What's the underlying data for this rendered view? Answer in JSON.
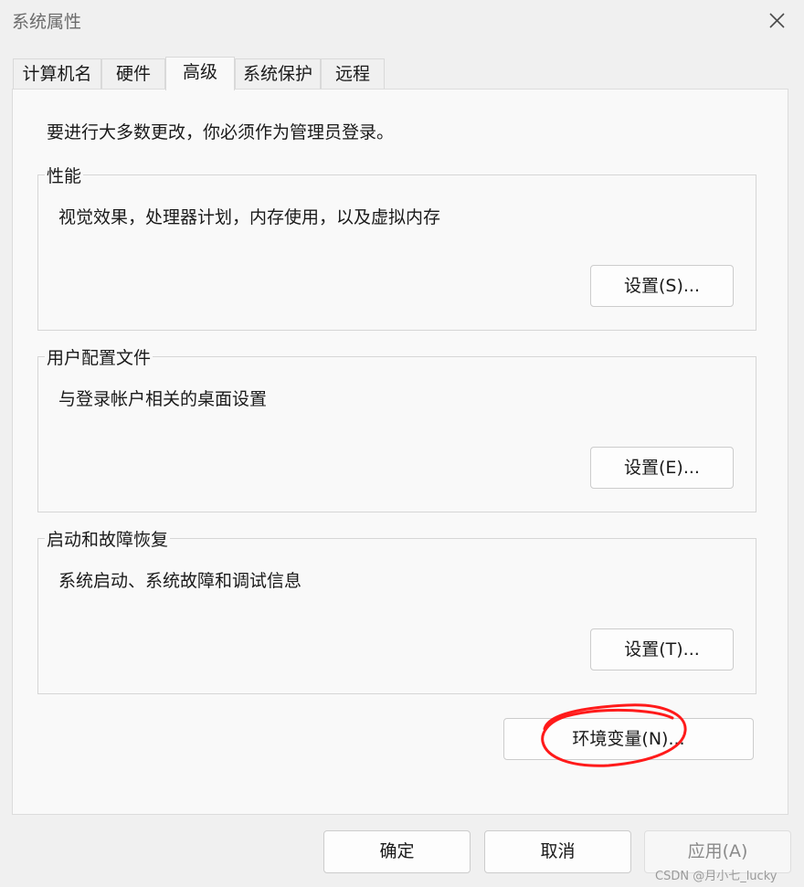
{
  "window": {
    "title": "系统属性"
  },
  "tabs": [
    {
      "label": "计算机名"
    },
    {
      "label": "硬件"
    },
    {
      "label": "高级"
    },
    {
      "label": "系统保护"
    },
    {
      "label": "远程"
    }
  ],
  "active_tab": "高级",
  "admin_note": "要进行大多数更改，你必须作为管理员登录。",
  "groups": {
    "performance": {
      "title": "性能",
      "description": "视觉效果，处理器计划，内存使用，以及虚拟内存",
      "button_label": "设置(S)..."
    },
    "user_profiles": {
      "title": "用户配置文件",
      "description": "与登录帐户相关的桌面设置",
      "button_label": "设置(E)..."
    },
    "startup_recovery": {
      "title": "启动和故障恢复",
      "description": "系统启动、系统故障和调试信息",
      "button_label": "设置(T)..."
    }
  },
  "env_button_label": "环境变量(N)...",
  "footer": {
    "ok_label": "确定",
    "cancel_label": "取消",
    "apply_label": "应用(A)"
  },
  "watermark": "CSDN @月小七_lucky",
  "colors": {
    "annotation_circle": "#ff1a1a",
    "window_background": "#f0f0f0",
    "panel_background": "#f9f9f9"
  },
  "icons": {
    "close": "close-icon"
  }
}
